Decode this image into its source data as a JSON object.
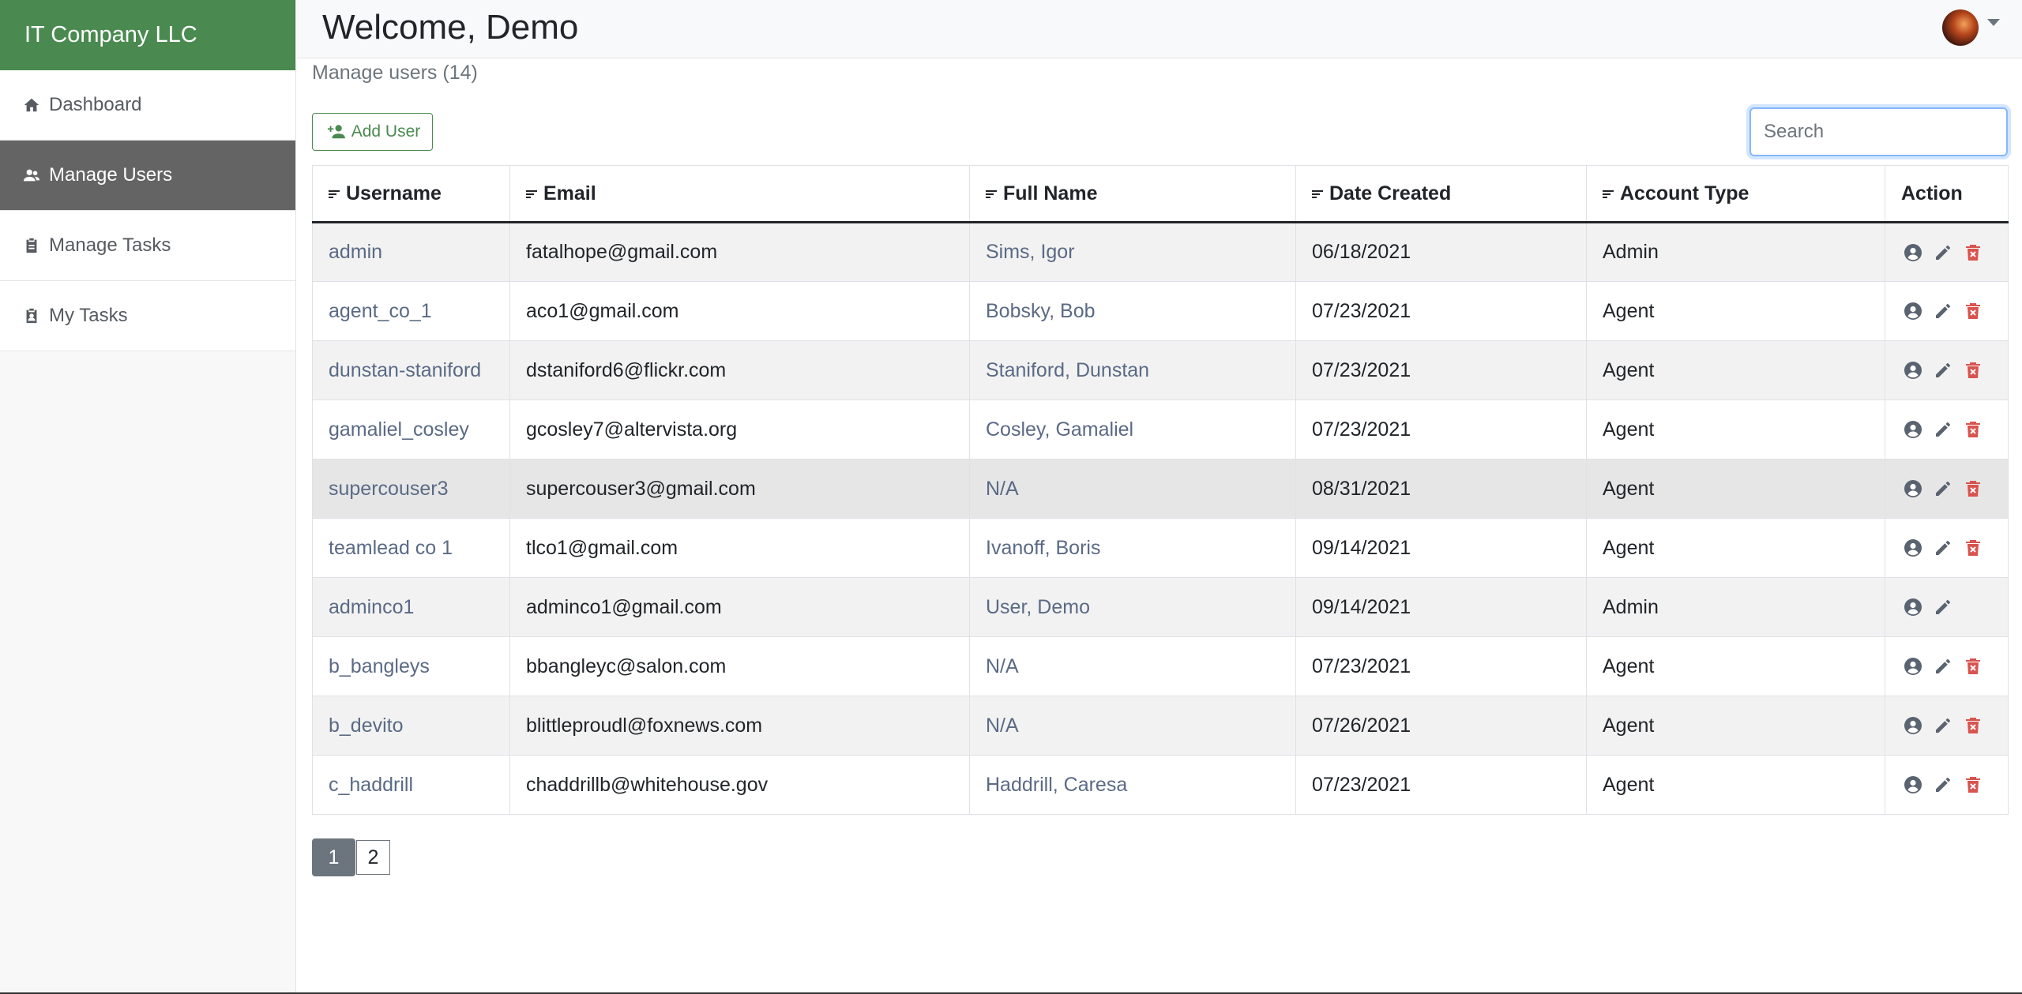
{
  "sidebar": {
    "brand": "IT Company LLC",
    "items": [
      {
        "label": "Dashboard",
        "icon": "home-icon",
        "active": false
      },
      {
        "label": "Manage Users",
        "icon": "users-icon",
        "active": true
      },
      {
        "label": "Manage Tasks",
        "icon": "clipboard-icon",
        "active": false
      },
      {
        "label": "My Tasks",
        "icon": "clipboard-user-icon",
        "active": false
      }
    ]
  },
  "header": {
    "welcome": "Welcome, Demo"
  },
  "main": {
    "subtitle": "Manage users (14)",
    "add_user_label": "Add User",
    "search_placeholder": "Search",
    "search_value": ""
  },
  "table": {
    "columns": [
      "Username",
      "Email",
      "Full Name",
      "Date Created",
      "Account Type",
      "Action"
    ],
    "rows": [
      {
        "username": "admin",
        "email": "fatalhope@gmail.com",
        "full_name": "Sims, Igor",
        "date_created": "06/18/2021",
        "account_type": "Admin",
        "can_delete": true
      },
      {
        "username": "agent_co_1",
        "email": "aco1@gmail.com",
        "full_name": "Bobsky, Bob",
        "date_created": "07/23/2021",
        "account_type": "Agent",
        "can_delete": true
      },
      {
        "username": "dunstan-staniford",
        "email": "dstaniford6@flickr.com",
        "full_name": "Staniford, Dunstan",
        "date_created": "07/23/2021",
        "account_type": "Agent",
        "can_delete": true
      },
      {
        "username": "gamaliel_cosley",
        "email": "gcosley7@altervista.org",
        "full_name": "Cosley, Gamaliel",
        "date_created": "07/23/2021",
        "account_type": "Agent",
        "can_delete": true
      },
      {
        "username": "supercouser3",
        "email": "supercouser3@gmail.com",
        "full_name": "N/A",
        "date_created": "08/31/2021",
        "account_type": "Agent",
        "can_delete": true
      },
      {
        "username": "teamlead co 1",
        "email": "tlco1@gmail.com",
        "full_name": "Ivanoff, Boris",
        "date_created": "09/14/2021",
        "account_type": "Agent",
        "can_delete": true
      },
      {
        "username": "adminco1",
        "email": "adminco1@gmail.com",
        "full_name": "User, Demo",
        "date_created": "09/14/2021",
        "account_type": "Admin",
        "can_delete": false
      },
      {
        "username": "b_bangleys",
        "email": "bbangleyc@salon.com",
        "full_name": "N/A",
        "date_created": "07/23/2021",
        "account_type": "Agent",
        "can_delete": true
      },
      {
        "username": "b_devito",
        "email": "blittleproudl@foxnews.com",
        "full_name": "N/A",
        "date_created": "07/26/2021",
        "account_type": "Agent",
        "can_delete": true
      },
      {
        "username": "c_haddrill",
        "email": "chaddrillb@whitehouse.gov",
        "full_name": "Haddrill, Caresa",
        "date_created": "07/23/2021",
        "account_type": "Agent",
        "can_delete": true
      }
    ]
  },
  "pagination": {
    "pages": [
      "1",
      "2"
    ],
    "current": "1"
  },
  "colors": {
    "brand": "#4a8a50",
    "sidebar_active": "#646464",
    "link": "#5a6a85",
    "action_icon": "#5a6370",
    "delete_icon": "#d9534f"
  }
}
